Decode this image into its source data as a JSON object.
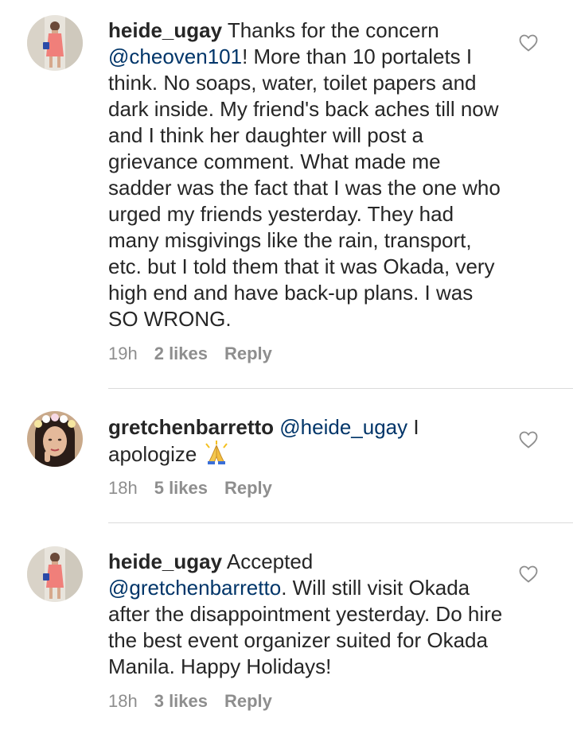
{
  "comments": [
    {
      "username": "heide_ugay",
      "pre_mention": "Thanks for the concern",
      "mention": "@cheoven101",
      "post_mention": "! More than 10 portalets I think. No soaps, water, toilet papers and dark inside. My friend's back aches till now and I think her daughter will post a grievance comment. What made me sadder was the fact that I was the one who urged my friends yesterday. They had many misgivings like the rain, transport, etc. but I told them that it was Okada, very high end and have back-up plans. I was SO WRONG.",
      "time": "19h",
      "likes": "2 likes",
      "reply": "Reply",
      "avatar_icon": "profile-photo-woman-pink-dress"
    },
    {
      "username": "gretchenbarretto",
      "mention": "@heide_ugay",
      "post_mention": " I apologize",
      "emoji": "folded-hands-emoji",
      "time": "18h",
      "likes": "5 likes",
      "reply": "Reply",
      "avatar_icon": "profile-photo-woman-flower-crown"
    },
    {
      "username": "heide_ugay",
      "pre_mention": "Accepted",
      "mention": "@gretchenbarretto",
      "post_mention": ". Will still visit Okada after the disappointment yesterday. Do hire the best event organizer suited for Okada Manila. Happy Holidays!",
      "time": "18h",
      "likes": "3 likes",
      "reply": "Reply",
      "avatar_icon": "profile-photo-woman-pink-dress"
    }
  ],
  "colors": {
    "text": "#262626",
    "mention": "#003569",
    "meta": "#8e8e8e",
    "divider": "#dbdbdb"
  },
  "icons": {
    "like": "heart-outline-icon"
  }
}
